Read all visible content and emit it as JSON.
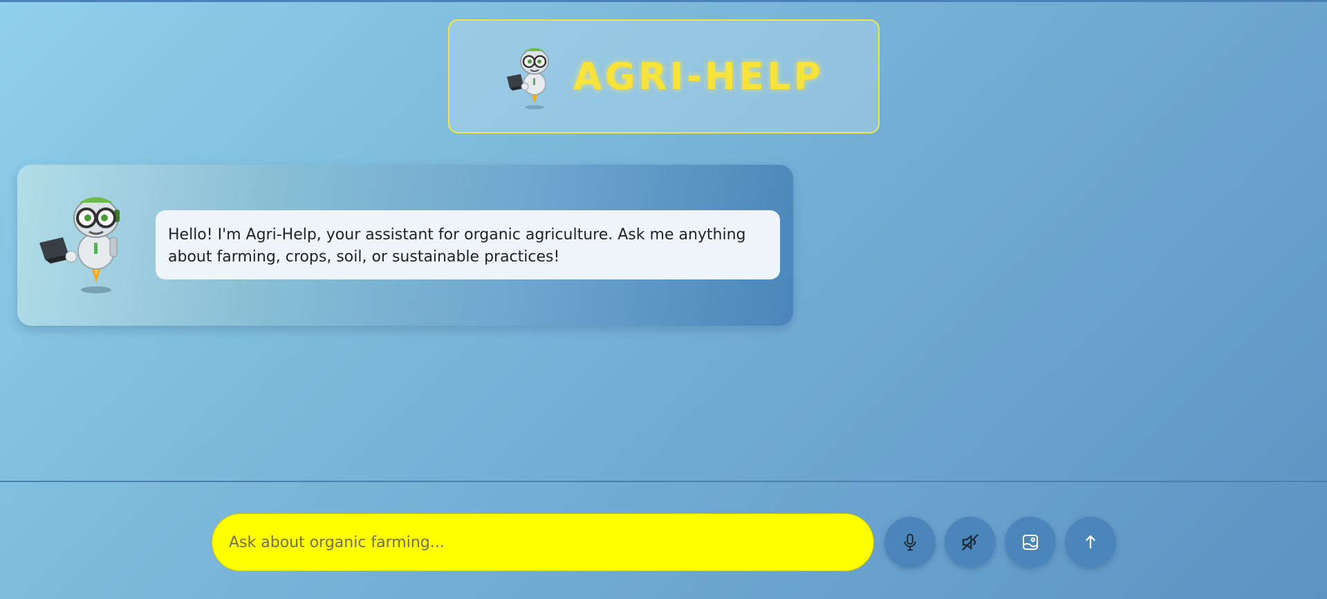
{
  "header": {
    "title": "AGRI-HELP"
  },
  "chat": {
    "messages": [
      {
        "role": "bot",
        "text": "Hello! I'm Agri-Help, your assistant for organic agriculture. Ask me anything about farming, crops, soil, or sustainable practices!"
      }
    ]
  },
  "input": {
    "placeholder": "Ask about organic farming...",
    "value": ""
  },
  "controls": {
    "icons": [
      "microphone-icon",
      "speaker-muted-icon",
      "image-upload-icon",
      "send-arrow-icon"
    ]
  },
  "colors": {
    "title": "#f7e33a",
    "input_bg": "#ffff00",
    "button_bg": "#4a86ba",
    "bubble_bg": "#eff4f8"
  }
}
